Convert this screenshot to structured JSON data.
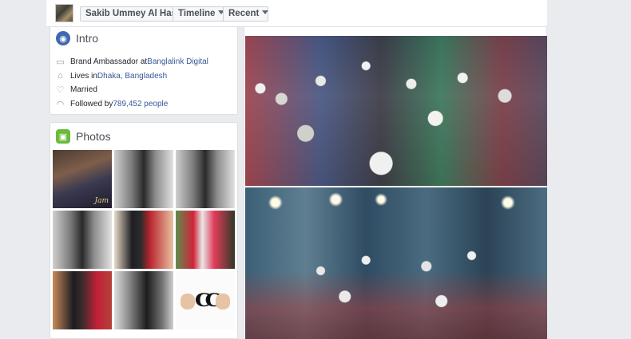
{
  "topbar": {
    "profile_name": "Sakib Ummey Al Hasan",
    "timeline_label": "Timeline",
    "recent_label": "Recent"
  },
  "intro": {
    "title": "Intro",
    "items": [
      {
        "icon": "briefcase-icon",
        "prefix": "Brand Ambassador at ",
        "link": "Banglalink Digital"
      },
      {
        "icon": "home-icon",
        "prefix": "Lives in ",
        "link": "Dhaka, Bangladesh"
      },
      {
        "icon": "heart-icon",
        "prefix": "Married",
        "link": ""
      },
      {
        "icon": "rss-icon",
        "prefix": "Followed by ",
        "link": "789,452 people"
      }
    ]
  },
  "photos": {
    "title": "Photos",
    "tile_label": "Jam"
  },
  "colors": {
    "link": "#365899",
    "intro_icon": "#4267b2",
    "photos_icon": "#6bba3b"
  }
}
